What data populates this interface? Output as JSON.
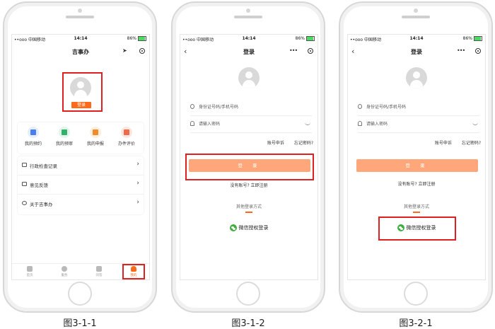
{
  "status": {
    "carrier": "••ooo 中国移动",
    "time": "14:14",
    "battery": "86%"
  },
  "colors": {
    "accent": "#ff6a1a",
    "highlight": "#e02020",
    "login_disabled": "#ffa77a",
    "wechat": "#3fae3f"
  },
  "phone1": {
    "title": "吉事办",
    "login_chip": "登录",
    "grid": [
      {
        "label": "我的预约",
        "icon": "calendar-icon",
        "color": "#4a7df0"
      },
      {
        "label": "我的预审",
        "icon": "check-doc-icon",
        "color": "#2fb36a"
      },
      {
        "label": "我的申报",
        "icon": "report-icon",
        "color": "#f08a2a"
      },
      {
        "label": "办件评价",
        "icon": "rating-icon",
        "color": "#f06a4a"
      }
    ],
    "menu": [
      {
        "label": "行政检查记录",
        "icon": "message-icon"
      },
      {
        "label": "意见反馈",
        "icon": "edit-icon"
      },
      {
        "label": "关于吉事办",
        "icon": "info-icon"
      }
    ],
    "tabs": [
      {
        "label": "首页",
        "icon": "home-icon"
      },
      {
        "label": "服务",
        "icon": "service-icon"
      },
      {
        "label": "问答",
        "icon": "qa-icon"
      },
      {
        "label": "我的",
        "icon": "profile-icon"
      }
    ]
  },
  "phone2": {
    "title": "登录",
    "account_placeholder": "身份证号码/手机号码",
    "password_placeholder": "请输入密码",
    "complain": "账号申诉",
    "forgot": "忘记密码?",
    "login_button": "登 录",
    "register": "没有账号? 立即注册",
    "other_login": "其他登录方式",
    "wechat_login": "微信授权登录"
  },
  "phone3": {
    "title": "登录",
    "account_placeholder": "身份证号码/手机号码",
    "password_placeholder": "请输入密码",
    "complain": "账号申诉",
    "forgot": "忘记密码?",
    "login_button": "登 录",
    "register": "没有账号? 立即注册",
    "other_login": "其他登录方式",
    "wechat_login": "微信授权登录"
  },
  "captions": [
    "图3-1-1",
    "图3-1-2",
    "图3-2-1"
  ]
}
